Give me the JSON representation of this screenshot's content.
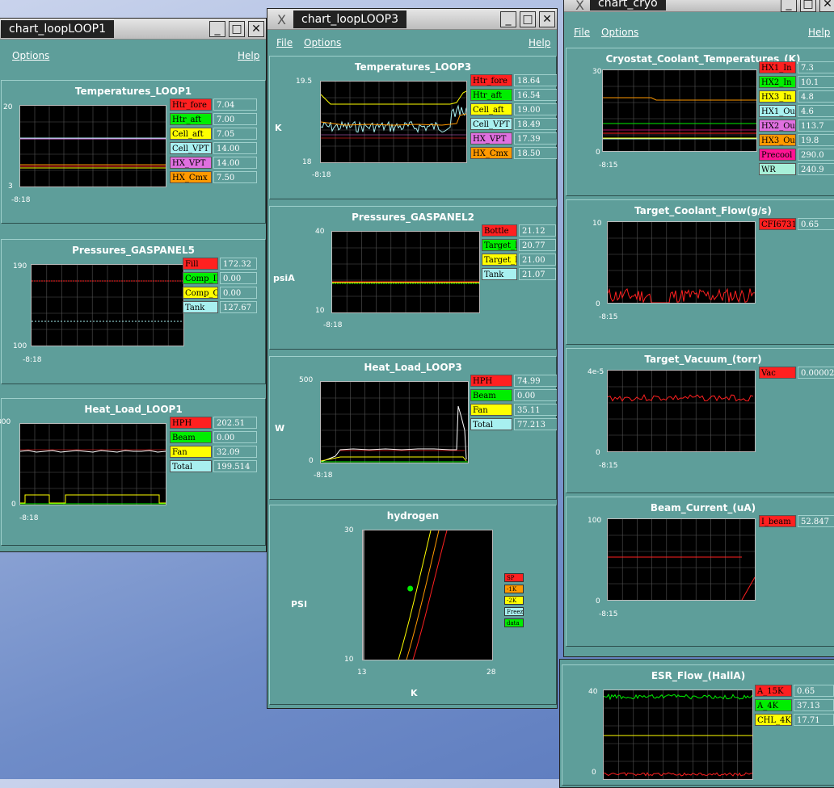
{
  "windows": {
    "loop1": {
      "title": "chart_loopLOOP1",
      "menu": {
        "options": "Options",
        "help": "Help"
      }
    },
    "loop3": {
      "title": "chart_loopLOOP3",
      "menu": {
        "file": "File",
        "options": "Options",
        "help": "Help"
      }
    },
    "cryo": {
      "title": "chart_cryo",
      "menu": {
        "file": "File",
        "options": "Options",
        "help": "Help"
      }
    }
  },
  "window_buttons": {
    "minimize": "_",
    "maximize": "□",
    "close": "✕"
  },
  "panels": {
    "temps_loop1": {
      "title": "Temperatures_LOOP1",
      "ymax": "20",
      "ymin": "3",
      "xlabel": "-8:18",
      "legend": [
        {
          "name": "Htr_fore",
          "value": "7.04",
          "color": "#ff2020"
        },
        {
          "name": "Htr_aft",
          "value": "7.00",
          "color": "#00ee00"
        },
        {
          "name": "Cell_aft",
          "value": "7.05",
          "color": "#ffff00"
        },
        {
          "name": "Cell_VPT",
          "value": "14.00",
          "color": "#a8f0f0"
        },
        {
          "name": "HX_VPT",
          "value": "14.00",
          "color": "#e070e0"
        },
        {
          "name": "HX_Cmx",
          "value": "7.50",
          "color": "#ff9900"
        }
      ]
    },
    "press_gp5": {
      "title": "Pressures_GASPANEL5",
      "ymax": "190",
      "ymin": "100",
      "xlabel": "-8:18",
      "legend": [
        {
          "name": "Fill",
          "value": "172.32",
          "color": "#ff2020"
        },
        {
          "name": "Comp_IN",
          "value": "0.00",
          "color": "#00ee00"
        },
        {
          "name": "Comp_OUT",
          "value": "0.00",
          "color": "#ffff00"
        },
        {
          "name": "Tank",
          "value": "127.67",
          "color": "#a8f0f0"
        }
      ]
    },
    "heat_loop1": {
      "title": "Heat_Load_LOOP1",
      "ymax": "300",
      "ymin": "0",
      "xlabel": "-8:18",
      "legend": [
        {
          "name": "HPH",
          "value": "202.51",
          "color": "#ff2020"
        },
        {
          "name": "Beam",
          "value": "0.00",
          "color": "#00ee00"
        },
        {
          "name": "Fan",
          "value": "32.09",
          "color": "#ffff00"
        },
        {
          "name": "Total",
          "value": "199.514",
          "color": "#a8f0f0"
        }
      ]
    },
    "temps_loop3": {
      "title": "Temperatures_LOOP3",
      "ymax": "19.5",
      "ymin": "18",
      "ylabel": "K",
      "xlabel": "-8:18",
      "legend": [
        {
          "name": "Htr_fore",
          "value": "18.64",
          "color": "#ff2020"
        },
        {
          "name": "Htr_aft",
          "value": "16.54",
          "color": "#00ee00"
        },
        {
          "name": "Cell_aft",
          "value": "19.00",
          "color": "#ffff00"
        },
        {
          "name": "Cell_VPT",
          "value": "18.49",
          "color": "#a8f0f0"
        },
        {
          "name": "HX_VPT",
          "value": "17.39",
          "color": "#e070e0"
        },
        {
          "name": "HX_Cmx",
          "value": "18.50",
          "color": "#ff9900"
        }
      ]
    },
    "press_gp2": {
      "title": "Pressures_GASPANEL2",
      "ymax": "40",
      "ymin": "10",
      "ylabel": "psiA",
      "xlabel": "-8:18",
      "legend": [
        {
          "name": "Bottle",
          "value": "21.12",
          "color": "#ff2020"
        },
        {
          "name": "Target_Fill",
          "value": "20.77",
          "color": "#00ee00"
        },
        {
          "name": "Target_Exh",
          "value": "21.00",
          "color": "#ffff00"
        },
        {
          "name": "Tank",
          "value": "21.07",
          "color": "#a8f0f0"
        }
      ]
    },
    "heat_loop3": {
      "title": "Heat_Load_LOOP3",
      "ymax": "500",
      "ymin": "0",
      "ylabel": "W",
      "xlabel": "-8:18",
      "legend": [
        {
          "name": "HPH",
          "value": "74.99",
          "color": "#ff2020"
        },
        {
          "name": "Beam",
          "value": "0.00",
          "color": "#00ee00"
        },
        {
          "name": "Fan",
          "value": "35.11",
          "color": "#ffff00"
        },
        {
          "name": "Total",
          "value": "77.213",
          "color": "#a8f0f0"
        }
      ]
    },
    "hydrogen": {
      "title": "hydrogen",
      "ymax": "30",
      "ymin": "10",
      "xmin": "13",
      "xmax": "28",
      "ylabel": "PSI",
      "xlabel": "K",
      "legend": [
        {
          "name": "SP",
          "color": "#ff2020"
        },
        {
          "name": "-1K",
          "color": "#ff9900"
        },
        {
          "name": "-2K",
          "color": "#ffff00"
        },
        {
          "name": "Freeze",
          "color": "#a8f0f0"
        },
        {
          "name": "data",
          "color": "#00ee00"
        }
      ],
      "point": {
        "x": 18.5,
        "y": 21
      }
    },
    "cryo_temps": {
      "title": "Cryostat_Coolant_Temperatures_(K)",
      "ymax": "30",
      "ymin": "0",
      "xlabel": "-8:15",
      "legend": [
        {
          "name": "HX1_In",
          "value": "7.3",
          "color": "#ff2020"
        },
        {
          "name": "HX2_In",
          "value": "10.1",
          "color": "#00ee00"
        },
        {
          "name": "HX3_In",
          "value": "4.8",
          "color": "#ffff00"
        },
        {
          "name": "HX1_Out",
          "value": "4.6",
          "color": "#a8f0f0"
        },
        {
          "name": "HX2_Out",
          "value": "113.7",
          "color": "#e070e0"
        },
        {
          "name": "HX3_Out",
          "value": "19.8",
          "color": "#ff9900"
        },
        {
          "name": "Precool",
          "value": "290.0",
          "color": "#ff1493"
        },
        {
          "name": "WR",
          "value": "240.9",
          "color": "#a8f0d8"
        }
      ]
    },
    "coolant_flow": {
      "title": "Target_Coolant_Flow(g/s)",
      "ymax": "10",
      "ymin": "0",
      "xlabel": "-8:15",
      "legend": [
        {
          "name": "CFI6731A",
          "value": "0.65",
          "color": "#ff2020"
        }
      ]
    },
    "vacuum": {
      "title": "Target_Vacuum_(torr)",
      "ymax": "4e-5",
      "ymin": "0",
      "xlabel": "-8:15",
      "legend": [
        {
          "name": "Vac",
          "value": "0.0000280",
          "color": "#ff2020"
        }
      ]
    },
    "beam_current": {
      "title": "Beam_Current_(uA)",
      "ymax": "100",
      "ymin": "0",
      "xlabel": "-8:15",
      "legend": [
        {
          "name": "I_beam",
          "value": "52.847",
          "color": "#ff2020"
        }
      ]
    },
    "esr_flow": {
      "title": "ESR_Flow_(HallA)",
      "ymax": "40",
      "ymin": "0",
      "legend": [
        {
          "name": "A_15K",
          "value": "0.65",
          "color": "#ff2020"
        },
        {
          "name": "A_4K",
          "value": "37.13",
          "color": "#00ee00"
        },
        {
          "name": "CHL_4K",
          "value": "17.71",
          "color": "#ffff00"
        }
      ]
    }
  }
}
